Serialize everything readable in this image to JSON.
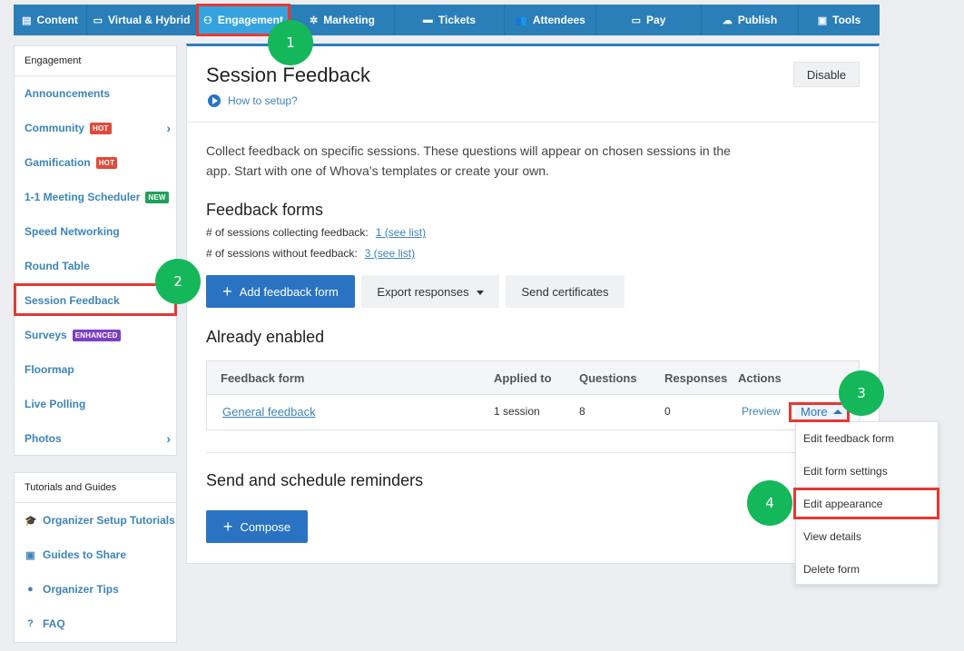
{
  "nav": {
    "items": [
      {
        "label": "Content",
        "icon": "list-icon"
      },
      {
        "label": "Virtual & Hybrid",
        "icon": "laptop-icon"
      },
      {
        "label": "Engagement",
        "icon": "network-icon"
      },
      {
        "label": "Marketing",
        "icon": "megaphone-icon"
      },
      {
        "label": "Tickets",
        "icon": "ticket-icon"
      },
      {
        "label": "Attendees",
        "icon": "users-icon"
      },
      {
        "label": "Pay",
        "icon": "card-icon"
      },
      {
        "label": "Publish",
        "icon": "cloud-upload-icon"
      },
      {
        "label": "Tools",
        "icon": "toolbox-icon"
      }
    ],
    "active": "Engagement"
  },
  "callouts": [
    "1",
    "2",
    "3",
    "4"
  ],
  "sidebar": {
    "heading": "Engagement",
    "items": [
      {
        "label": "Announcements"
      },
      {
        "label": "Community",
        "tag": "HOT"
      },
      {
        "label": "Gamification",
        "tag": "HOT"
      },
      {
        "label": "1-1 Meeting Scheduler",
        "tag": "NEW"
      },
      {
        "label": "Speed Networking"
      },
      {
        "label": "Round Table"
      },
      {
        "label": "Session Feedback"
      },
      {
        "label": "Surveys",
        "tag": "ENHANCED"
      },
      {
        "label": "Floormap"
      },
      {
        "label": "Live Polling"
      },
      {
        "label": "Photos"
      }
    ]
  },
  "tutorials": {
    "heading": "Tutorials and Guides",
    "items": [
      {
        "label": "Organizer Setup Tutorials",
        "icon": "graduation-cap-icon"
      },
      {
        "label": "Guides to Share",
        "icon": "share-screen-icon"
      },
      {
        "label": "Organizer Tips",
        "icon": "lightbulb-icon"
      },
      {
        "label": "FAQ",
        "icon": "question-circle-icon"
      }
    ]
  },
  "main": {
    "title": "Session Feedback",
    "disable_label": "Disable",
    "howto_label": "How to setup?",
    "description": "Collect feedback on specific sessions. These questions will appear on chosen sessions in the app. Start with one of Whova’s templates or create your own.",
    "forms_heading": "Feedback forms",
    "stat_collecting_label": "# of sessions collecting feedback:",
    "stat_collecting_link": "1 (see list)",
    "stat_without_label": "# of sessions without feedback:",
    "stat_without_link": "3 (see list)",
    "add_form_label": "Add feedback form",
    "export_label": "Export responses",
    "certificates_label": "Send certificates",
    "enabled_heading": "Already enabled",
    "table": {
      "headers": [
        "Feedback form",
        "Applied to",
        "Questions",
        "Responses",
        "Actions"
      ],
      "row": {
        "form": "General feedback",
        "applied": "1 session",
        "questions": "8",
        "responses": "0",
        "preview": "Preview",
        "more": "More"
      }
    },
    "reminders_heading": "Send and schedule reminders",
    "compose_label": "Compose"
  },
  "dropdown": {
    "items": [
      "Edit feedback form",
      "Edit form settings",
      "Edit appearance",
      "View details",
      "Delete form"
    ]
  }
}
